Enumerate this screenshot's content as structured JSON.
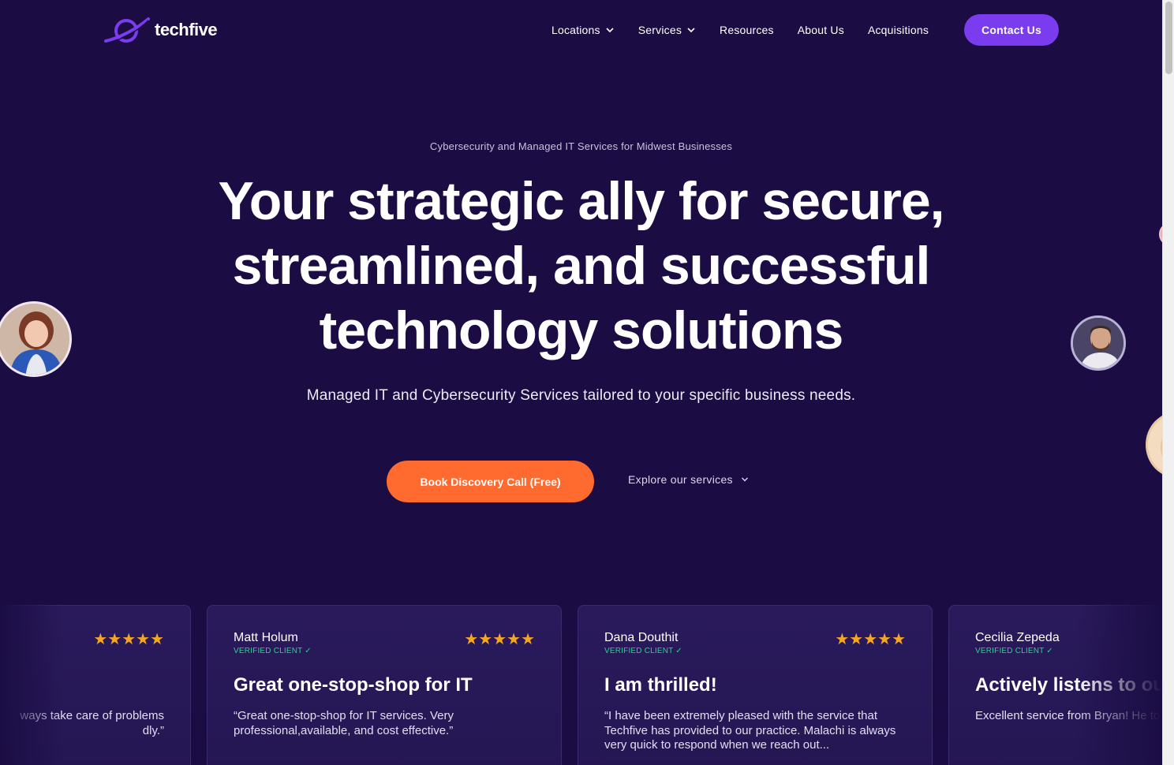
{
  "brand": {
    "name": "techfive"
  },
  "nav": {
    "items": [
      {
        "label": "Locations",
        "has_dropdown": true
      },
      {
        "label": "Services",
        "has_dropdown": true
      },
      {
        "label": "Resources",
        "has_dropdown": false
      },
      {
        "label": "About Us",
        "has_dropdown": false
      },
      {
        "label": "Acquisitions",
        "has_dropdown": false
      }
    ],
    "contact_label": "Contact Us"
  },
  "hero": {
    "eyebrow": "Cybersecurity and Managed IT Services for Midwest Businesses",
    "headline_lines": [
      "Your strategic ally for secure,",
      "streamlined, and successful",
      "technology solutions"
    ],
    "subhead": "Managed IT and Cybersecurity Services tailored to your specific business needs.",
    "cta_label": "Book Discovery Call (Free)",
    "explore_label": "Explore our services"
  },
  "reviews": [
    {
      "name": "",
      "verified": "",
      "stars": "★★★★★",
      "title": "",
      "text": "ways take care of problems\ndly.”"
    },
    {
      "name": "Matt Holum",
      "verified": "VERIFIED CLIENT ✓",
      "stars": "★★★★★",
      "title": "Great one-stop-shop for IT",
      "text": "“Great one-stop-shop for IT services. Very professional,available, and cost effective.”"
    },
    {
      "name": "Dana Douthit",
      "verified": "VERIFIED CLIENT ✓",
      "stars": "★★★★★",
      "title": "I am thrilled!",
      "text": "“I have been extremely pleased with the service that Techfive has provided to our practice. Malachi is always very quick to respond when we reach out..."
    },
    {
      "name": "Cecilia Zepeda",
      "verified": "VERIFIED CLIENT ✓",
      "stars": "",
      "title": "Actively listens to ou",
      "text": "Excellent service from Bryan! He to actively listen to our needs. He"
    }
  ],
  "colors": {
    "background": "#1b0d44",
    "accent": "#7b3cf0",
    "cta": "#ff6a2f",
    "stars": "#f5a623",
    "verified": "#2fd08a"
  }
}
